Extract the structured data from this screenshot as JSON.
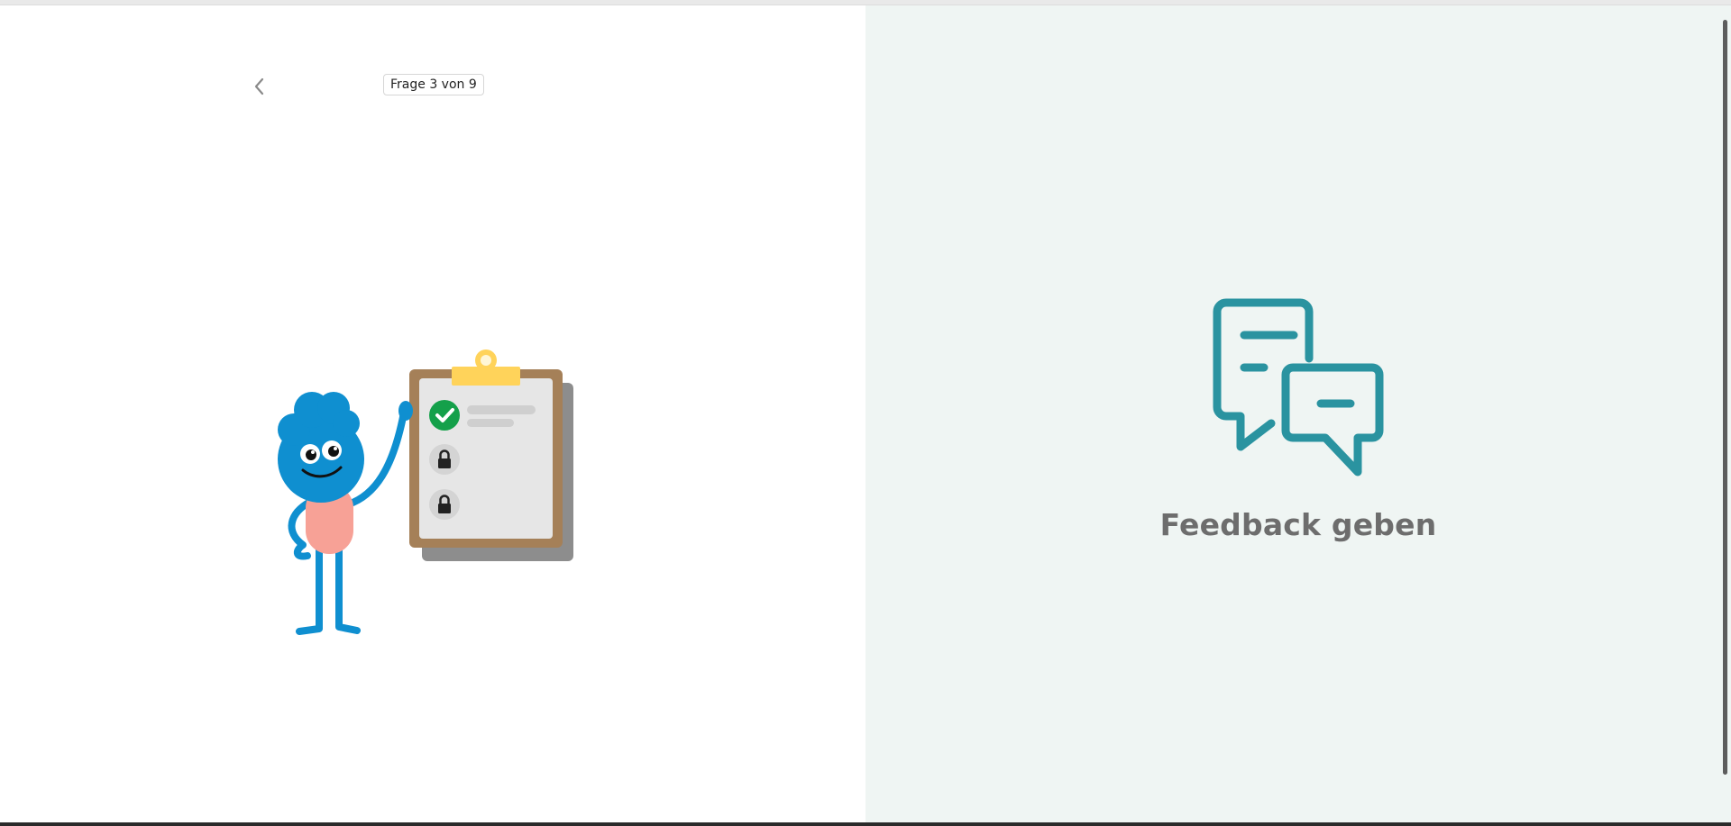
{
  "header": {
    "progress_label": "Frage 3 von 9"
  },
  "icons": {
    "back": "chevron-left-icon",
    "feedback": "chat-bubbles-icon"
  },
  "feedback": {
    "label": "Feedback geben"
  },
  "colors": {
    "right_panel_bg": "#eff5f3",
    "feedback_icon": "#2a93a0",
    "feedback_text": "#6d6d6d",
    "character_blue": "#0f8fd0",
    "character_body": "#f7a196",
    "clipboard_brown": "#a58058",
    "clip_yellow": "#ffd35a",
    "check_green": "#14a04a"
  }
}
